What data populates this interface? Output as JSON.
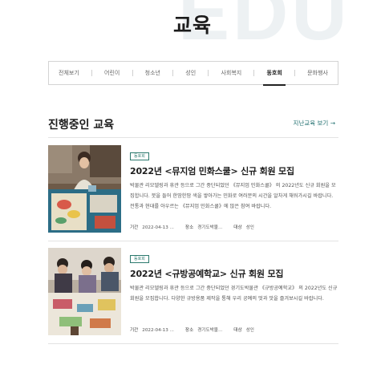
{
  "page": {
    "background_text": "EDU",
    "title": "교육"
  },
  "tabs": [
    {
      "label": "전체보기",
      "active": false
    },
    {
      "label": "어린이",
      "active": false
    },
    {
      "label": "청소년",
      "active": false
    },
    {
      "label": "성인",
      "active": false
    },
    {
      "label": "사회복지",
      "active": false
    },
    {
      "label": "동호회",
      "active": true
    },
    {
      "label": "문화행사",
      "active": false
    }
  ],
  "section": {
    "title": "진행중인 교육",
    "more_link": "지난교육 보기 →"
  },
  "cards": [
    {
      "badge": "동호회",
      "title": "2022년 <뮤지엄 민화스쿨> 신규 회원 모집",
      "description": "박물관 리모델링과 휴관 등으로 그간 중단되었던 《뮤지엄 민화스쿨》 의 2022년도 신규 회원을 모집합니다. 붓을 들어 한땀한땀 색을 쌓아가는 민화로 여러분의 시간을 알차게 채워가시길 바랍니다. 전통과 현대를 아우르는 《뮤지엄 민화스쿨》에 많은 참여 바랍니다.",
      "meta": {
        "period_label": "기간",
        "period": "2022-04-13 ...",
        "place_label": "장소",
        "place": "경기도박물...",
        "target_label": "대상",
        "target": "성인"
      },
      "image": "painting-class-photo"
    },
    {
      "badge": "동호회",
      "title": "2022년 <규방공예학교> 신규 회원 모집",
      "description": "박물관 리모델링과 휴관 등으로 그간 중단되었던 경기도박물관 《규방공예학교》 의 2022년도 신규 회원을 모집합니다. 다양한 규방용품 제작을 통해 우리 공예의 멋과 맛을 즐겨보시길 바랍니다.",
      "meta": {
        "period_label": "기간",
        "period": "2022-04-13 ...",
        "place_label": "장소",
        "place": "경기도박물...",
        "target_label": "대상",
        "target": "성인"
      },
      "image": "craft-class-photo"
    }
  ],
  "colors": {
    "accent": "#2c7a6e",
    "link": "#1e6e6e",
    "text": "#1c1c1c"
  }
}
